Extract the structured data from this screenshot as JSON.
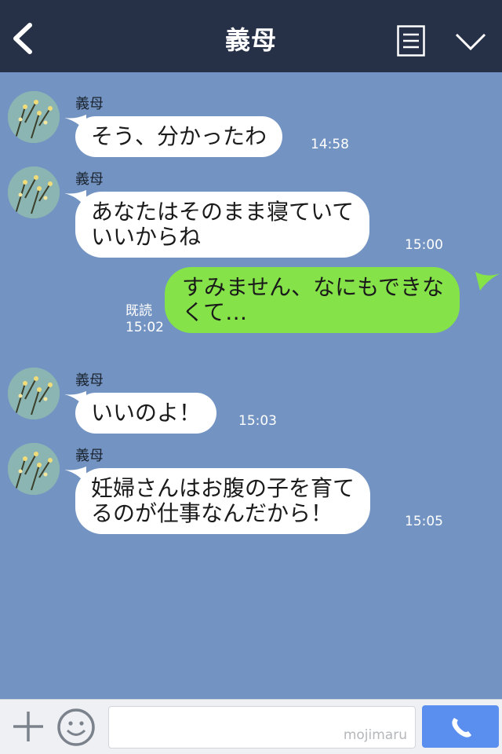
{
  "header": {
    "title": "義母",
    "back_icon": "chevron-left-icon",
    "menu_icon": "menu-list-icon",
    "more_icon": "chevron-down-icon"
  },
  "messages": [
    {
      "direction": "in",
      "sender": "義母",
      "text": "そう、分かったわ",
      "time": "14:58"
    },
    {
      "direction": "in",
      "sender": "義母",
      "text": "あなたはそのまま寝ていて\nいいからね",
      "time": "15:00"
    },
    {
      "direction": "out",
      "text": "すみません、なにもできな\nくて…",
      "read_label": "既読",
      "time": "15:02"
    },
    {
      "direction": "in",
      "sender": "義母",
      "text": "いいのよ！",
      "time": "15:03"
    },
    {
      "direction": "in",
      "sender": "義母",
      "text": "妊婦さんはお腹の子を育て\nるのが仕事なんだから！",
      "time": "15:05"
    }
  ],
  "footer": {
    "plus_icon": "plus-icon",
    "emoji_icon": "emoji-icon",
    "input_value": "",
    "watermark": "mojimaru",
    "call_icon": "phone-icon"
  },
  "colors": {
    "header_bg": "#263148",
    "chat_bg": "#7394c2",
    "incoming_bubble": "#ffffff",
    "outgoing_bubble": "#85e249",
    "call_button": "#5a8ff0"
  }
}
